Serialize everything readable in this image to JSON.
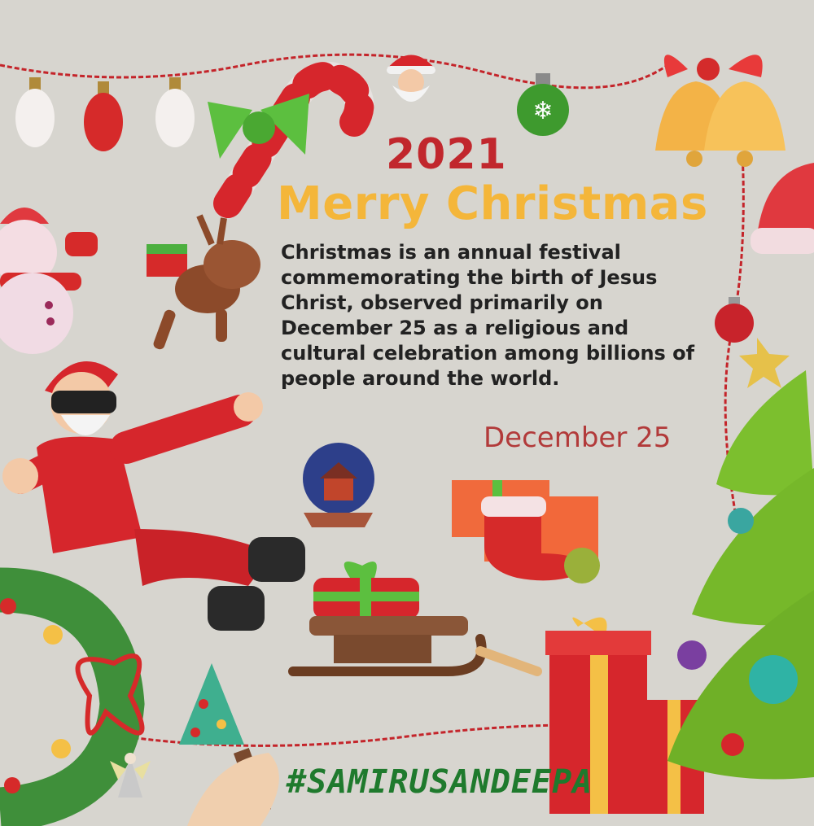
{
  "card": {
    "year": "2021",
    "title": "Merry Christmas",
    "body_lines": [
      "Christmas is an annual festival",
      "commemorating the birth of Jesus",
      "Christ, observed primarily on",
      "December 25 as a religious and",
      "cultural celebration among billions of",
      "people around the world."
    ],
    "date": "December 25",
    "hashtag": "#SAMIRUSANDEEPA"
  },
  "colors": {
    "background": "#d7d5cf",
    "year": "#c1272d",
    "title": "#f4b63a",
    "body": "#222222",
    "date": "#b23a3a",
    "hashtag": "#1f7a2d"
  },
  "decorations": [
    "string-lights-icon",
    "candy-cane-icon",
    "santa-face-icon",
    "ornament-ball-icon",
    "bells-icon",
    "snowman-icon",
    "reindeer-icon",
    "santa-vr-icon",
    "snow-globe-icon",
    "gift-stocking-icon",
    "sled-gift-icon",
    "gift-box-icon",
    "christmas-tree-icon",
    "wreath-icon",
    "mini-tree-hand-icon",
    "santa-hat-icon",
    "red-ornament-icon",
    "angel-ornament-icon"
  ]
}
